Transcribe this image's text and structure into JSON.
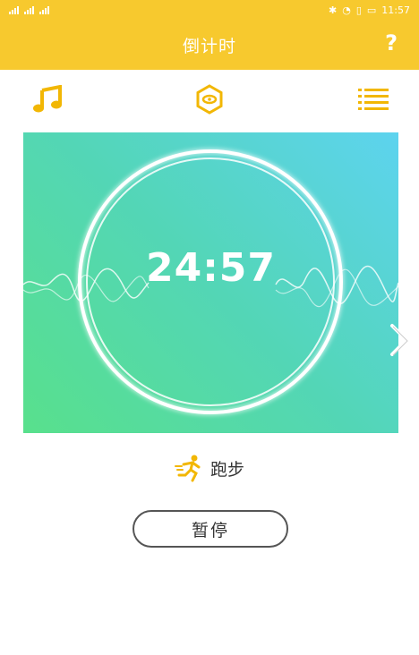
{
  "status_bar": {
    "left_text": "WiFi ..ıl ..ıl",
    "time": "11:57",
    "indicators": [
      "bluetooth-icon",
      "alarm-icon",
      "vibrate-icon",
      "battery-icon"
    ]
  },
  "header": {
    "title": "倒计时",
    "help_label": "?"
  },
  "toolbar": {
    "items": [
      {
        "icon": "music-note-icon"
      },
      {
        "icon": "hexagon-target-icon"
      },
      {
        "icon": "list-icon"
      }
    ]
  },
  "card": {
    "timer": "24:57",
    "gradient": [
      "#58e08c",
      "#5dd3ef"
    ]
  },
  "activity": {
    "icon": "runner-icon",
    "label": "跑步"
  },
  "controls": {
    "pause_label": "暂停"
  },
  "colors": {
    "accent": "#f7c92e",
    "white": "#ffffff"
  }
}
